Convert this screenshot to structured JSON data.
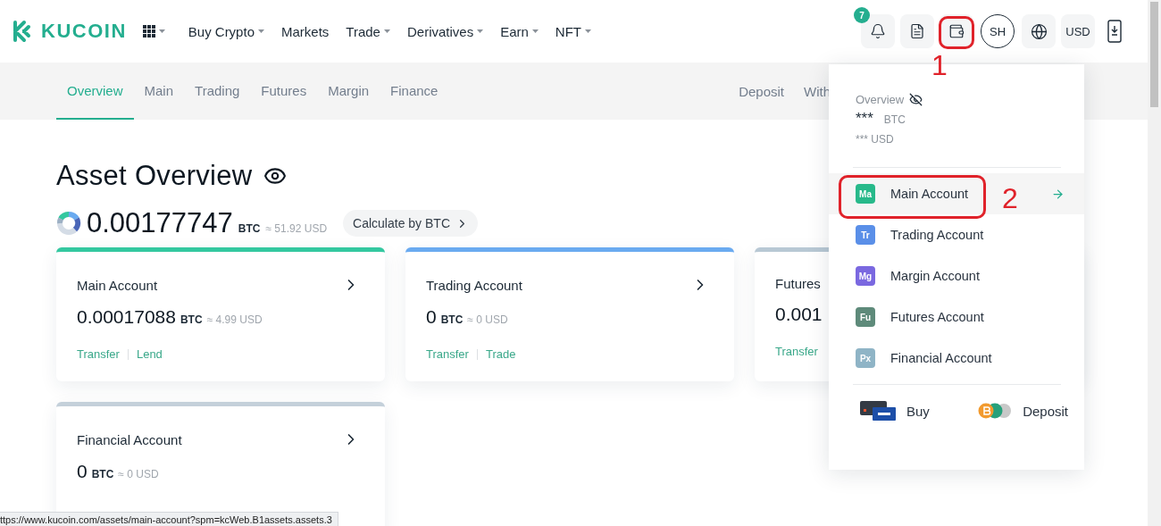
{
  "header": {
    "logo": "KUCOIN",
    "nav": [
      {
        "label": "Buy Crypto",
        "has_menu": true
      },
      {
        "label": "Markets",
        "has_menu": false
      },
      {
        "label": "Trade",
        "has_menu": true
      },
      {
        "label": "Derivatives",
        "has_menu": true
      },
      {
        "label": "Earn",
        "has_menu": true
      },
      {
        "label": "NFT",
        "has_menu": true
      }
    ],
    "notification_badge": "7",
    "avatar": "SH",
    "currency": "USD"
  },
  "subnav": {
    "tabs": [
      {
        "label": "Overview",
        "selected": true
      },
      {
        "label": "Main",
        "selected": false
      },
      {
        "label": "Trading",
        "selected": false
      },
      {
        "label": "Futures",
        "selected": false
      },
      {
        "label": "Margin",
        "selected": false
      },
      {
        "label": "Finance",
        "selected": false
      }
    ],
    "actions": [
      "Deposit",
      "With"
    ]
  },
  "overview": {
    "title": "Asset Overview",
    "total": "0.00177747",
    "unit": "BTC",
    "approx": "≈ 51.92 USD",
    "calculate_button": "Calculate by BTC"
  },
  "cards": [
    {
      "title": "Main Account",
      "amount": "0.00017088",
      "unit": "BTC",
      "approx": "≈ 4.99 USD",
      "links": [
        "Transfer",
        "Lend"
      ],
      "color": "#34c8a0"
    },
    {
      "title": "Trading Account",
      "amount": "0",
      "unit": "BTC",
      "approx": "≈ 0 USD",
      "links": [
        "Transfer",
        "Trade"
      ],
      "color": "#6aaaf0"
    },
    {
      "title": "Futures",
      "amount": "0.001",
      "links": [
        "Transfer"
      ],
      "color": "#b8c8d4"
    },
    {
      "title": "Financial Account",
      "amount": "0",
      "unit": "BTC",
      "approx": "≈ 0 USD",
      "color": "#c4d0da"
    }
  ],
  "wallet_menu": {
    "label": "Overview",
    "balance": "***",
    "unit": "BTC",
    "fiat": "*** USD",
    "accounts": [
      {
        "abbr": "Ma",
        "label": "Main Account",
        "color": "#27b98a",
        "selected": true
      },
      {
        "abbr": "Tr",
        "label": "Trading Account",
        "color": "#5a8fe8",
        "selected": false
      },
      {
        "abbr": "Mg",
        "label": "Margin Account",
        "color": "#7a68e0",
        "selected": false
      },
      {
        "abbr": "Fu",
        "label": "Futures Account",
        "color": "#5e8a7a",
        "selected": false
      },
      {
        "abbr": "Px",
        "label": "Financial Account",
        "color": "#8fb4c6",
        "selected": false
      }
    ],
    "actions": [
      {
        "kind": "buy",
        "label": "Buy"
      },
      {
        "kind": "deposit",
        "label": "Deposit"
      }
    ]
  },
  "annotations": [
    {
      "label": "1"
    },
    {
      "label": "2"
    }
  ],
  "status_url": "ttps://www.kucoin.com/assets/main-account?spm=kcWeb.B1assets.assets.3"
}
